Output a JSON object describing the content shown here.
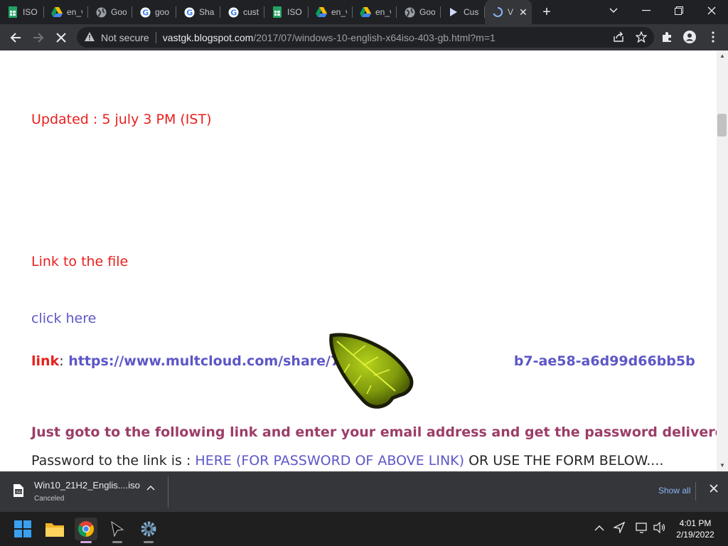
{
  "browser": {
    "tabs": [
      {
        "label": "ISO",
        "icon": "sheets-icon"
      },
      {
        "label": "en_v",
        "icon": "drive-icon"
      },
      {
        "label": "Goo",
        "icon": "globe-icon"
      },
      {
        "label": "goo",
        "icon": "google-icon"
      },
      {
        "label": "Shar",
        "icon": "google-icon"
      },
      {
        "label": "cust",
        "icon": "google-icon"
      },
      {
        "label": "ISO",
        "icon": "sheets-icon"
      },
      {
        "label": "en_v",
        "icon": "drive-icon"
      },
      {
        "label": "en_v",
        "icon": "drive-icon"
      },
      {
        "label": "Goo",
        "icon": "globe-icon"
      },
      {
        "label": "Cust",
        "icon": "play-icon"
      },
      {
        "label": "V",
        "icon": "loading-icon",
        "active": true
      }
    ],
    "new_tab": "+",
    "address": {
      "security": "Not secure",
      "host": "vastgk.blogspot.com",
      "path": "/2017/07/windows-10-english-x64iso-403-gb.html?m=1"
    }
  },
  "content": {
    "updated": "Updated : 5 july 3 PM (IST)",
    "link_heading": "Link to the file",
    "click_here": "click here",
    "link_label": "link",
    "link_colon": ":",
    "link_url": "https://www.multcloud.com/share/7977c7                   b7-ae58-a6d99d66bb5b",
    "instruction": "Just goto to the following link and enter your email address and get the password delivered to you..",
    "password_prefix": "Password to the link is : ",
    "password_link": "HERE (FOR PASSWORD OF ABOVE LINK)",
    "password_suffix": " OR USE THE FORM BELOW...."
  },
  "download": {
    "file_name": "Win10_21H2_Englis....iso",
    "status": "Canceled",
    "show_all": "Show all"
  },
  "taskbar": {
    "time": "4:01 PM",
    "date": "2/19/2022"
  },
  "colors": {
    "red": "#e8201d",
    "link_blue": "#5d57c6",
    "instruction_purple": "#9c3d68",
    "show_all_blue": "#8ab4f8"
  }
}
